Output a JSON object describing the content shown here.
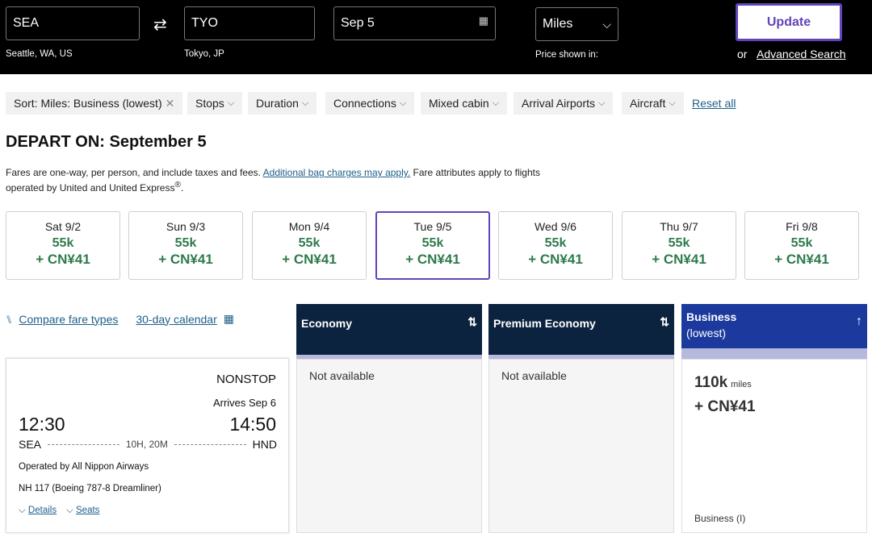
{
  "search": {
    "origin": "SEA",
    "origin_label": "Seattle, WA, US",
    "destination": "TYO",
    "destination_label": "Tokyo, JP",
    "date": "Sep 5",
    "currency": "Miles",
    "currency_label": "Price shown in:",
    "update": "Update",
    "or": "or",
    "advanced": "Advanced Search"
  },
  "filters": {
    "sort": "Sort: Miles: Business (lowest)",
    "items": [
      "Stops",
      "Duration",
      "Connections",
      "Mixed cabin",
      "Arrival Airports",
      "Aircraft"
    ],
    "reset": "Reset all"
  },
  "heading": {
    "prefix": "DEPART ON:",
    "date": "September 5"
  },
  "notice": {
    "text1": "Fares are one-way, per person, and include taxes and fees.",
    "link": "Additional bag charges may apply.",
    "text2": "Fare attributes apply to flights operated by United and United Express",
    "reg": "®",
    "end": "."
  },
  "days": [
    {
      "day": "Sat 9/2",
      "miles": "55k",
      "cash": "+ CN¥41"
    },
    {
      "day": "Sun 9/3",
      "miles": "55k",
      "cash": "+ CN¥41"
    },
    {
      "day": "Mon 9/4",
      "miles": "55k",
      "cash": "+ CN¥41"
    },
    {
      "day": "Tue 9/5",
      "miles": "55k",
      "cash": "+ CN¥41",
      "selected": true
    },
    {
      "day": "Wed 9/6",
      "miles": "55k",
      "cash": "+ CN¥41"
    },
    {
      "day": "Thu 9/7",
      "miles": "55k",
      "cash": "+ CN¥41"
    },
    {
      "day": "Fri 9/8",
      "miles": "55k",
      "cash": "+ CN¥41"
    }
  ],
  "tools": {
    "compare": "Compare fare types",
    "calendar": "30-day calendar"
  },
  "columns": {
    "economy": {
      "title": "Economy",
      "body": "Not available"
    },
    "premium": {
      "title": "Premium Economy",
      "body": "Not available"
    },
    "business": {
      "title": "Business",
      "subtitle": "(lowest)",
      "miles": "110k",
      "miles_unit": "miles",
      "cash": "+ CN¥41",
      "fare_class": "Business (I)"
    }
  },
  "flight": {
    "stops": "NONSTOP",
    "arrives": "Arrives Sep 6",
    "depart_time": "12:30",
    "arrive_time": "14:50",
    "from": "SEA",
    "to": "HND",
    "duration": "10H, 20M",
    "operator": "Operated by All Nippon Airways",
    "flight_no": "NH 117 (Boeing 787-8 Dreamliner)",
    "details": "Details",
    "seats": "Seats"
  },
  "colors": {
    "navy": "#0c2340",
    "business": "#1c3a9e",
    "green": "#2e7a4b",
    "selected": "#6244bb"
  }
}
